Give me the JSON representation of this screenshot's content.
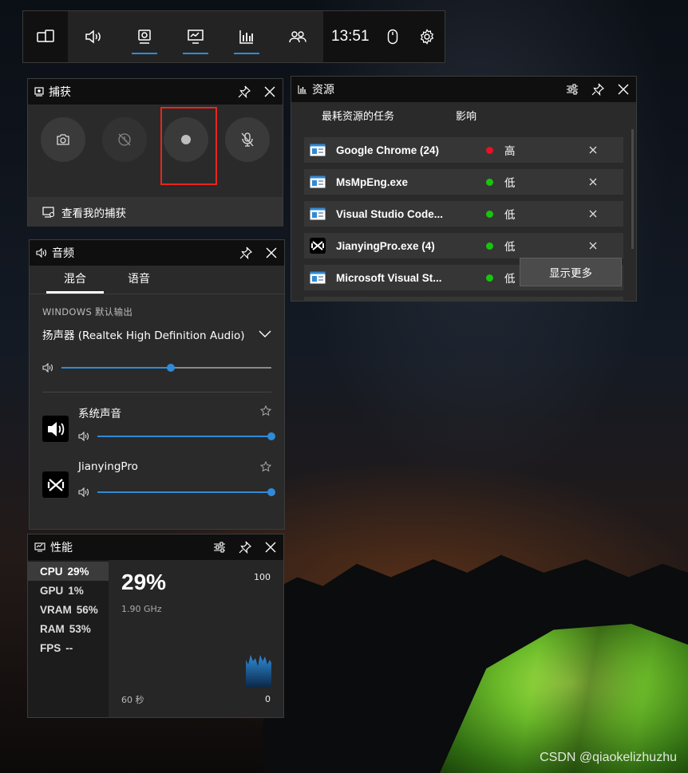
{
  "topbar": {
    "clock": "13:51"
  },
  "capture": {
    "title": "捕获",
    "link_label": "查看我的捕获"
  },
  "audio": {
    "title": "音频",
    "tabs": [
      "混合",
      "语音"
    ],
    "section_label": "WINDOWS 默认输出",
    "device": "扬声器 (Realtek High Definition Audio)",
    "master_volume": 0.52,
    "apps": [
      {
        "name": "系统声音",
        "volume": 1.0
      },
      {
        "name": "JianyingPro",
        "volume": 1.0
      }
    ]
  },
  "performance": {
    "title": "性能",
    "items": [
      {
        "label": "CPU",
        "value": "29%"
      },
      {
        "label": "GPU",
        "value": "1%"
      },
      {
        "label": "VRAM",
        "value": "56%"
      },
      {
        "label": "RAM",
        "value": "53%"
      },
      {
        "label": "FPS",
        "value": "--"
      }
    ],
    "big_value": "29%",
    "frequency": "1.90 GHz",
    "axis_max": "100",
    "axis_min": "0",
    "duration": "60 秒"
  },
  "resources": {
    "title": "资源",
    "col_task": "最耗资源的任务",
    "col_impact": "影响",
    "rows": [
      {
        "name": "Google Chrome (24)",
        "impact": "高",
        "status_color": "#e81123",
        "icon": "window-icon"
      },
      {
        "name": "MsMpEng.exe",
        "impact": "低",
        "status_color": "#16c60c",
        "icon": "window-icon"
      },
      {
        "name": "Visual Studio Code...",
        "impact": "低",
        "status_color": "#16c60c",
        "icon": "window-icon"
      },
      {
        "name": "JianyingPro.exe (4)",
        "impact": "低",
        "status_color": "#16c60c",
        "icon": "capcut-icon"
      },
      {
        "name": "Microsoft Visual St...",
        "impact": "低",
        "status_color": "#16c60c",
        "icon": "window-icon"
      }
    ],
    "show_more": "显示更多"
  },
  "watermark": "CSDN @qiaokelizhuzhu"
}
